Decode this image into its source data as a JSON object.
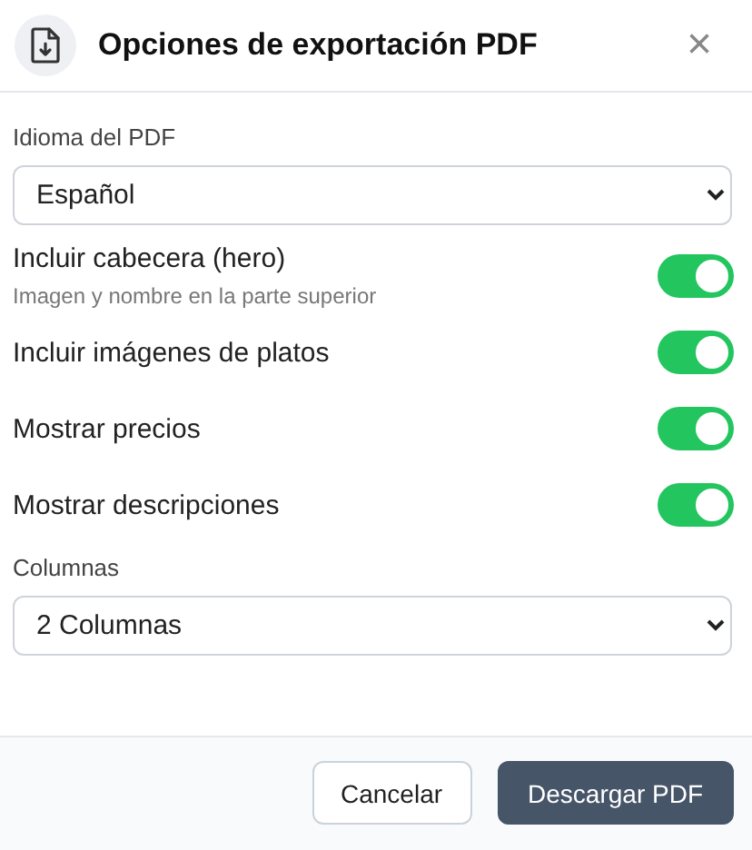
{
  "dialog": {
    "title": "Opciones de exportación PDF",
    "close": "×"
  },
  "language": {
    "label": "Idioma del PDF",
    "value": "Español"
  },
  "toggles": [
    {
      "label": "Incluir cabecera (hero)",
      "hint": "Imagen y nombre en la parte superior",
      "on": true
    },
    {
      "label": "Incluir imágenes de platos",
      "on": true
    },
    {
      "label": "Mostrar precios",
      "on": true
    },
    {
      "label": "Mostrar descripciones",
      "on": true
    }
  ],
  "columns": {
    "label": "Columnas",
    "value": "2 Columnas"
  },
  "buttons": [
    {
      "label": "Cancelar",
      "kind": "secondary"
    },
    {
      "label": "Descargar PDF",
      "kind": "primary"
    }
  ]
}
